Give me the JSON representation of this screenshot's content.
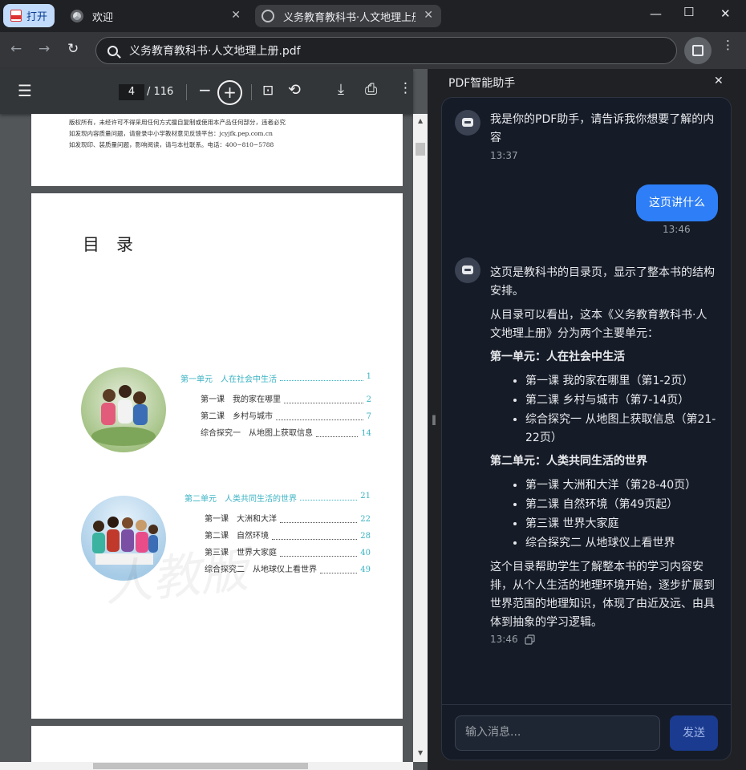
{
  "window": {
    "open_label": "打开",
    "tabs": [
      {
        "title": "欢迎",
        "icon": "chrome-icon"
      },
      {
        "title": "义务教育教科书·人文地理上册.pdf",
        "icon": "globe-icon"
      }
    ]
  },
  "toolbar": {
    "url": "义务教育教科书·人文地理上册.pdf"
  },
  "pdf": {
    "current_page": "4",
    "total_pages": "/ 116",
    "prev_page_lines": [
      "版权所有，未经许可不得采用任何方式擅自复制或使用本产品任何部分，违者必究",
      "如发现内容质量问题，请登录中小学教材意见反馈平台：jcyjfk.pep.com.cn",
      "如发现印、装质量问题，影响阅读，请与本社联系。电话：400−810−5788"
    ],
    "toc_title": "目　录",
    "unit1": {
      "title": "第一单元　人在社会中生活",
      "page": "1",
      "items": [
        {
          "label": "第一课　我的家在哪里",
          "page": "2"
        },
        {
          "label": "第二课　乡村与城市",
          "page": "7"
        },
        {
          "label": "综合探究一　从地图上获取信息",
          "page": "14"
        }
      ]
    },
    "unit2": {
      "title": "第二单元　人类共同生活的世界",
      "page": "21",
      "items": [
        {
          "label": "第一课　大洲和大洋",
          "page": "22"
        },
        {
          "label": "第二课　自然环境",
          "page": "28"
        },
        {
          "label": "第三课　世界大家庭",
          "page": "40"
        },
        {
          "label": "综合探究二　从地球仪上看世界",
          "page": "49"
        }
      ]
    },
    "watermark": "人教版"
  },
  "assistant": {
    "title": "PDF智能助手",
    "messages": [
      {
        "role": "bot",
        "text": "我是你的PDF助手，请告诉我你想要了解的内容",
        "time": "13:37"
      },
      {
        "role": "user",
        "text": "这页讲什么",
        "time": "13:46"
      },
      {
        "role": "bot",
        "intro": "这页是教科书的目录页，显示了整本书的结构安排。",
        "para2": "从目录可以看出，这本《义务教育教科书·人文地理上册》分为两个主要单元：",
        "unit1_heading": "第一单元：人在社会中生活",
        "unit1_points": [
          "第一课 我的家在哪里（第1-2页）",
          "第二课 乡村与城市（第7-14页）",
          "综合探究一 从地图上获取信息（第21-22页）"
        ],
        "unit2_heading": "第二单元：人类共同生活的世界",
        "unit2_points": [
          "第一课 大洲和大洋（第28-40页）",
          "第二课 自然环境（第49页起）",
          "第三课 世界大家庭",
          "综合探究二 从地球仪上看世界"
        ],
        "conclusion": "这个目录帮助学生了解整本书的学习内容安排，从个人生活的地理环境开始，逐步扩展到世界范围的地理知识，体现了由近及远、由具体到抽象的学习逻辑。",
        "time": "13:46"
      }
    ],
    "input_placeholder": "输入消息...",
    "send_label": "发送"
  },
  "colors": {
    "accent": "#2d7ef7",
    "toc_teal": "#3bb3c3",
    "panel_bg": "#151b27"
  }
}
